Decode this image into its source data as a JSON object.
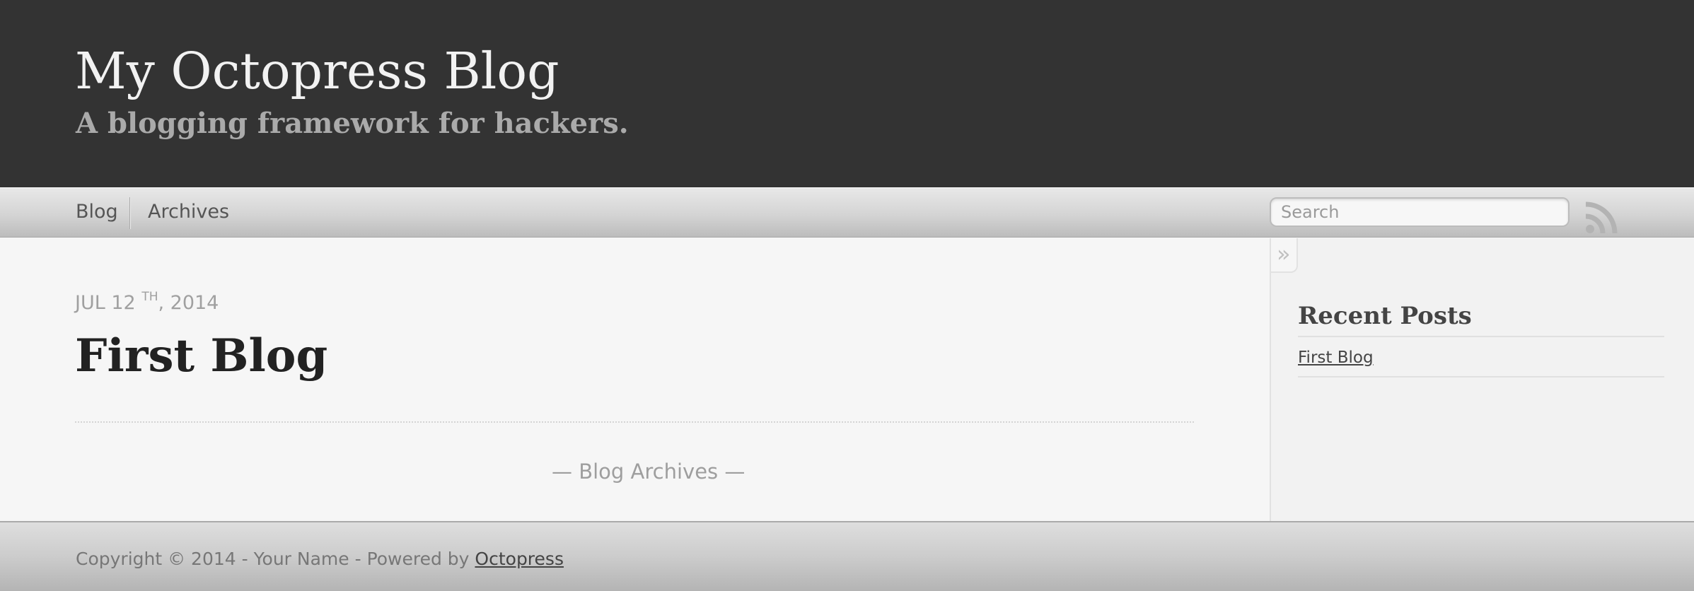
{
  "header": {
    "title": "My Octopress Blog",
    "subtitle": "A blogging framework for hackers."
  },
  "nav": {
    "items": [
      {
        "label": "Blog"
      },
      {
        "label": "Archives"
      }
    ],
    "search_placeholder": "Search",
    "rss_icon": "rss-icon"
  },
  "article": {
    "date_month_day": "JUL 12",
    "date_suffix": "TH",
    "date_year": ", 2014",
    "title": "First Blog",
    "archives_link": "— Blog Archives —"
  },
  "sidebar": {
    "collapse_label": "»",
    "recent_heading": "Recent Posts",
    "recent_posts": [
      {
        "label": "First Blog"
      }
    ]
  },
  "footer": {
    "text": "Copyright © 2014 - Your Name - Powered by ",
    "link_label": "Octopress"
  },
  "colors": {
    "header_bg": "#333333",
    "title": "#f2f2f2",
    "subtitle": "#aaaaaa",
    "body_bg": "#f6f6f6",
    "link": "#444444"
  }
}
